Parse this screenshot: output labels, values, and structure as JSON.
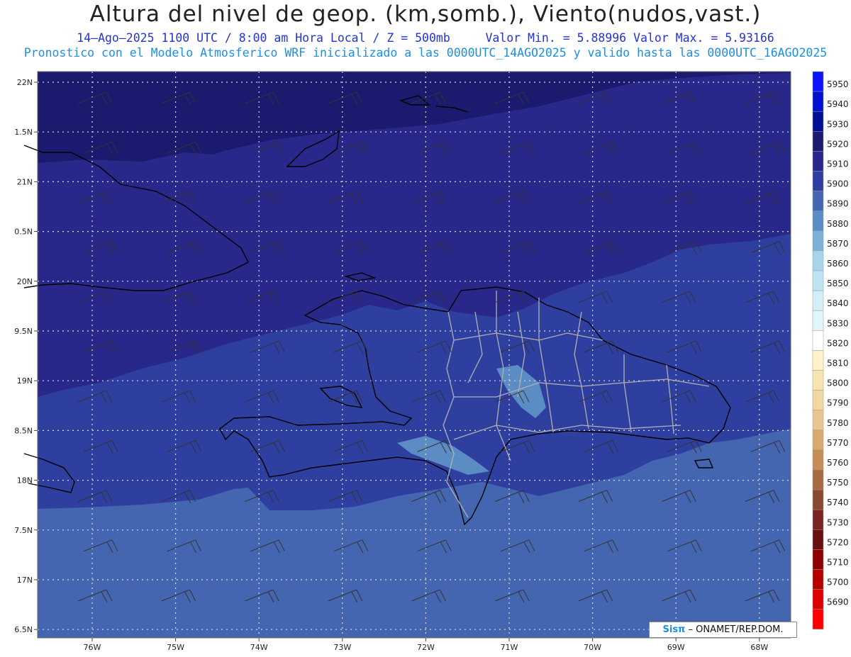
{
  "header": {
    "title": "Altura del nivel de geop. (km,somb.), Viento(nudos,vast.)",
    "line2_left": "14–Ago–2025  1100 UTC / 8:00 am Hora Local / Z = 500mb",
    "line2_right": "Valor Min. = 5.88996  Valor Max. = 5.93166",
    "line3": "Pronostico con el Modelo Atmosferico WRF inicializado a las 0000UTC_14AGO2025 y valido hasta las  0000UTC_16AGO2025"
  },
  "map": {
    "lat_labels": [
      "22N",
      "1.5N",
      "21N",
      "0.5N",
      "20N",
      "9.5N",
      "19N",
      "8.5N",
      "18N",
      "7.5N",
      "17N",
      "6.5N"
    ],
    "lon_labels": [
      "76W",
      "75W",
      "74W",
      "73W",
      "72W",
      "71W",
      "70W",
      "69W",
      "68W"
    ],
    "grid_lines": "dotted-white",
    "coastline_color": "#000000",
    "province_color": "#b0b0b0",
    "wind_barb_color": "#333333"
  },
  "colorbar": {
    "levels": [
      "5950",
      "5940",
      "5930",
      "5920",
      "5910",
      "5900",
      "5890",
      "5880",
      "5870",
      "5860",
      "5850",
      "5840",
      "5830",
      "5820",
      "5810",
      "5800",
      "5790",
      "5780",
      "5770",
      "5760",
      "5750",
      "5740",
      "5730",
      "5720",
      "5710",
      "5700",
      "5690"
    ],
    "colors": [
      "#0a14ff",
      "#0010d0",
      "#001094",
      "#1a1a6e",
      "#28288a",
      "#2f3fa0",
      "#4466b0",
      "#5b8dc4",
      "#7fb0d8",
      "#a7d4ea",
      "#bde4f0",
      "#d2eef6",
      "#e1f5fa",
      "#ffffff",
      "#fdf2c9",
      "#f7e4b0",
      "#f2d8a0",
      "#e9c690",
      "#d8aa72",
      "#c48e58",
      "#a86a42",
      "#8a4a30",
      "#7a2525",
      "#680f0f",
      "#8e0000",
      "#b60000",
      "#dd0000",
      "#ff0000"
    ]
  },
  "credit": {
    "brand": "Sisπ",
    "text": " – ONAMET/REP.DOM."
  }
}
